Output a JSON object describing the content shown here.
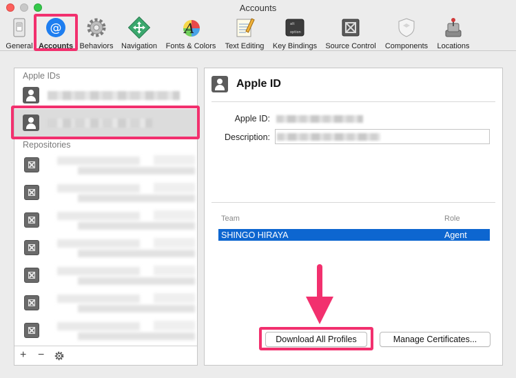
{
  "window": {
    "title": "Accounts"
  },
  "toolbar": {
    "items": [
      {
        "label": "General",
        "icon": "general-switch-icon"
      },
      {
        "label": "Accounts",
        "icon": "at-sign-icon"
      },
      {
        "label": "Behaviors",
        "icon": "gear-icon"
      },
      {
        "label": "Navigation",
        "icon": "navigation-arrows-icon"
      },
      {
        "label": "Fonts & Colors",
        "icon": "font-palette-icon"
      },
      {
        "label": "Text Editing",
        "icon": "notepad-pencil-icon"
      },
      {
        "label": "Key Bindings",
        "icon": "option-key-icon"
      },
      {
        "label": "Source Control",
        "icon": "source-control-icon"
      },
      {
        "label": "Components",
        "icon": "shield-icon"
      },
      {
        "label": "Locations",
        "icon": "joystick-icon"
      }
    ],
    "selected": "Accounts"
  },
  "sidebar": {
    "apple_ids_label": "Apple IDs",
    "repositories_label": "Repositories",
    "footer": {
      "add": "+",
      "remove": "−",
      "settings": "gear-icon"
    }
  },
  "detail": {
    "title": "Apple ID",
    "apple_id_label": "Apple ID:",
    "description_label": "Description:",
    "team_header": "Team",
    "role_header": "Role",
    "team_rows": [
      {
        "team": "SHINGO HIRAYA",
        "role": "Agent"
      }
    ],
    "download_button": "Download All Profiles",
    "manage_button": "Manage Certificates..."
  },
  "colors": {
    "highlight": "#f2306e",
    "selection": "#0d66d0",
    "accounts_icon": "#1e7ef0"
  }
}
